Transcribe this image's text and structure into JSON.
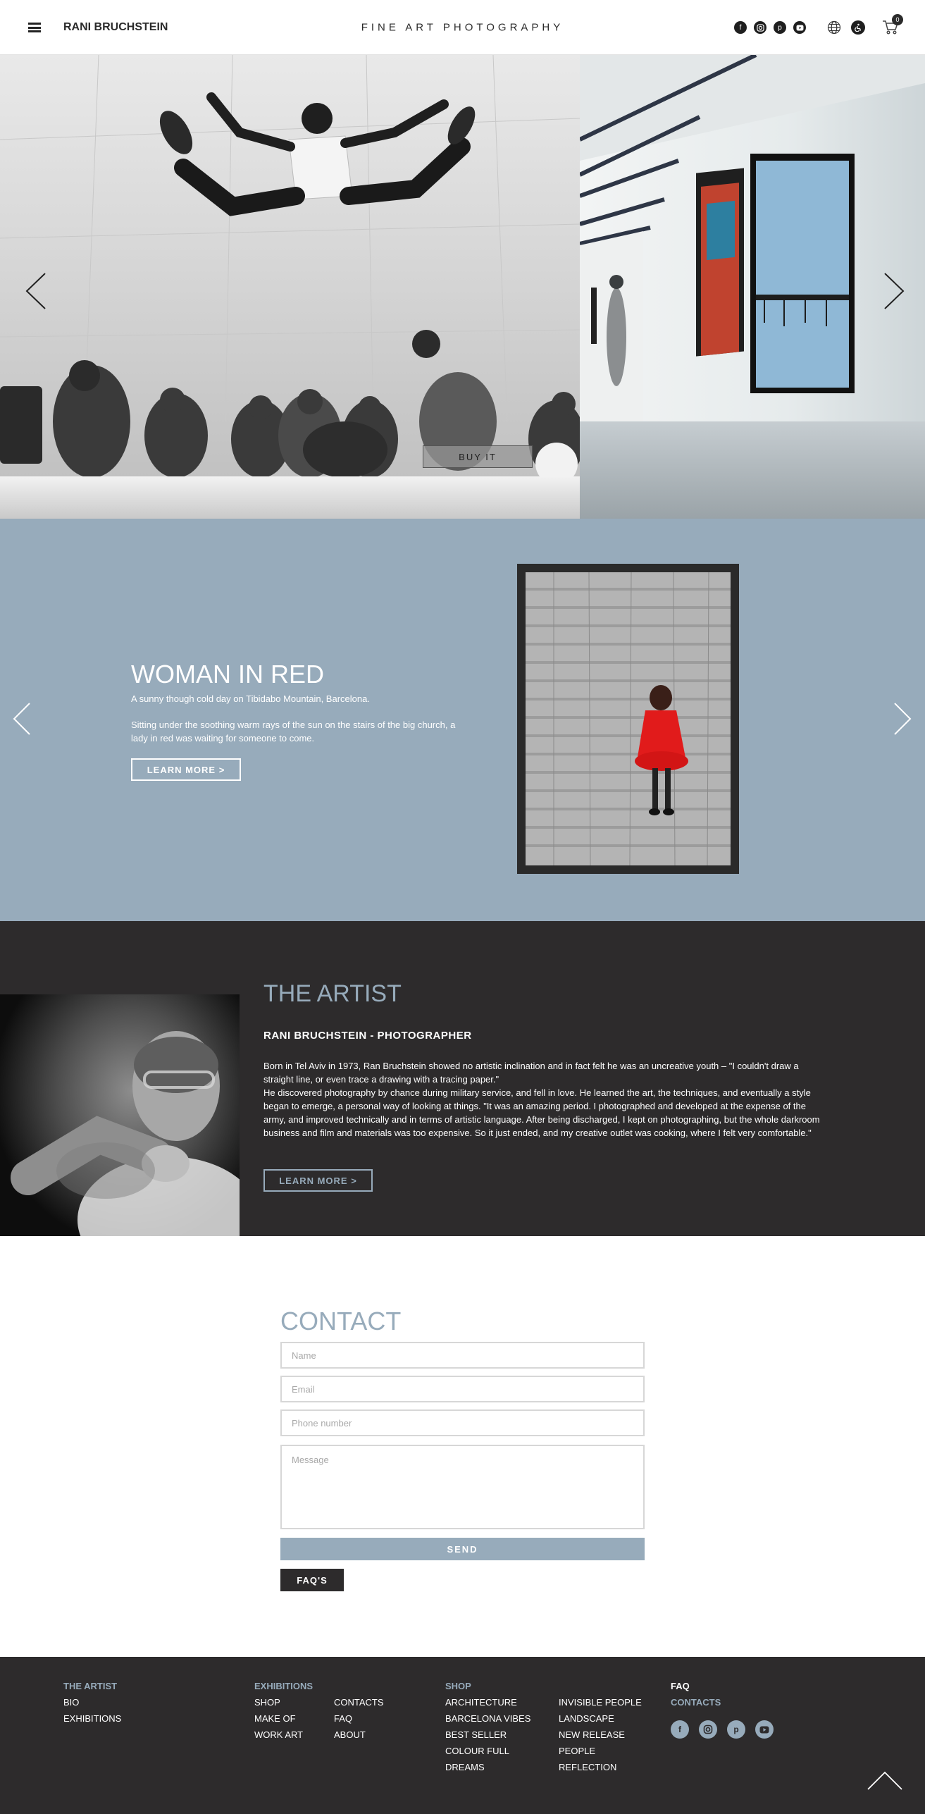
{
  "header": {
    "brand": "RANI BRUCHSTEIN",
    "tagline": "FINE ART PHOTOGRAPHY",
    "cart_count": "0",
    "social_icons": [
      "facebook-icon",
      "instagram-icon",
      "pinterest-icon",
      "youtube-icon"
    ],
    "utility_icons": [
      "globe-icon",
      "accessibility-icon",
      "cart-icon"
    ]
  },
  "hero": {
    "buy_label": "BUY IT",
    "icons": [
      "chevron-left-icon",
      "chevron-right-icon"
    ]
  },
  "feature": {
    "title": "WOMAN IN RED",
    "subtitle": "A sunny though cold day on Tibidabo Mountain, Barcelona.",
    "description": "Sitting under the soothing warm rays of the sun on the stairs of the big church, a lady in red was waiting for someone to come.",
    "button_label": "LEARN MORE   >"
  },
  "artist": {
    "heading": "THE ARTIST",
    "subheading": "RANI BRUCHSTEIN - PHOTOGRAPHER",
    "bio_1": "Born in Tel Aviv in 1973, Ran Bruchstein showed no artistic inclination and in fact felt he was an uncreative youth – \"I couldn't draw a straight line, or even trace a drawing with a tracing paper.\"",
    "bio_2": "He discovered photography by chance during military service, and fell in love. He learned the art, the techniques, and eventually a style began to emerge, a personal way of looking at things. \"It was an amazing period. I photographed and developed at the expense of the army, and improved technically and in terms of artistic language. After being discharged, I kept on photographing, but the whole darkroom business and film and materials was too expensive. So it just ended, and my creative outlet was cooking, where I felt very comfortable.\"",
    "button_label": "LEARN MORE   >"
  },
  "contact": {
    "heading": "CONTACT",
    "name_placeholder": "Name",
    "email_placeholder": "Email",
    "phone_placeholder": "Phone number",
    "message_placeholder": "Message",
    "send_label": "SEND",
    "faq_label": "FAQ'S"
  },
  "footer": {
    "artist_head": "THE ARTIST",
    "artist_links": [
      "BIO",
      "EXHIBITIONS"
    ],
    "exhibitions_head": "EXHIBITIONS",
    "exhibitions_links_a": [
      "SHOP",
      "MAKE OF",
      "WORK ART"
    ],
    "exhibitions_links_b": [
      "CONTACTS",
      "FAQ",
      "ABOUT"
    ],
    "shop_head": "SHOP",
    "shop_links_a": [
      "ARCHITECTURE",
      "BARCELONA VIBES",
      "BEST SELLER",
      "COLOUR FULL",
      "DREAMS"
    ],
    "shop_links_b": [
      "INVISIBLE PEOPLE",
      "LANDSCAPE",
      "NEW RELEASE",
      "PEOPLE",
      "REFLECTION"
    ],
    "faq_head": "FAQ",
    "contacts_head": "CONTACTS",
    "social_icons": [
      "facebook-icon",
      "instagram-icon",
      "pinterest-icon",
      "youtube-icon"
    ],
    "top_icon": "chevron-up-icon"
  },
  "colors": {
    "accent": "#97abbb",
    "dark": "#2d2b2c",
    "white": "#ffffff"
  }
}
